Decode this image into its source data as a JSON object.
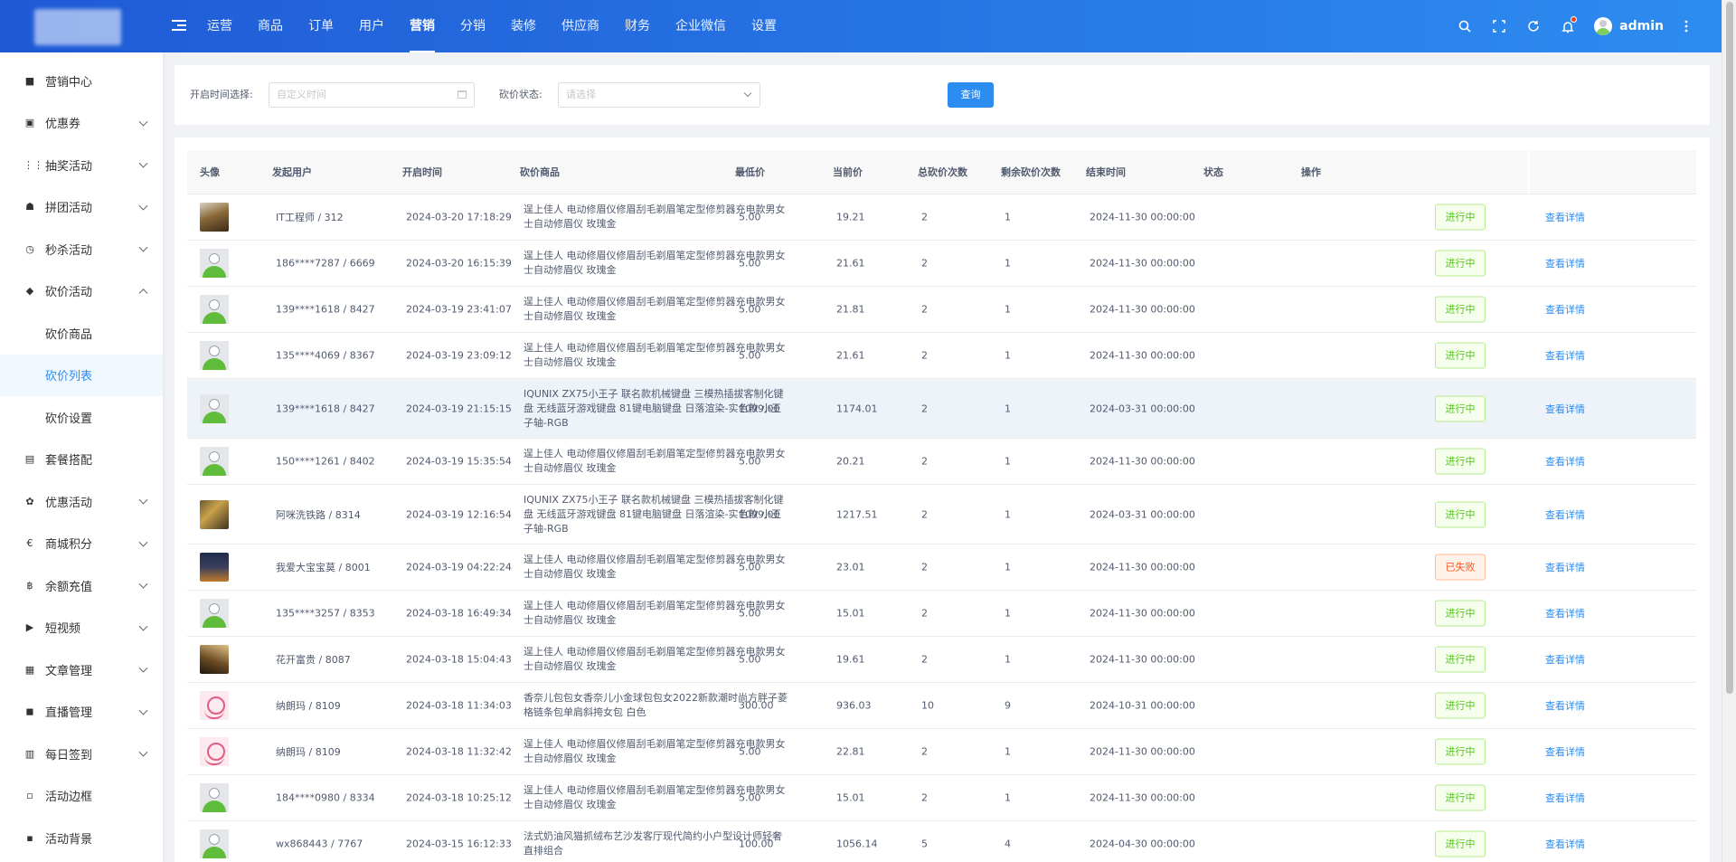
{
  "header": {
    "nav": [
      "运营",
      "商品",
      "订单",
      "用户",
      "营销",
      "分销",
      "装修",
      "供应商",
      "财务",
      "企业微信",
      "设置"
    ],
    "active_nav": 4,
    "username": "admin",
    "icons": [
      "search-icon",
      "fullscreen-icon",
      "refresh-icon",
      "bell-icon",
      "more-icon"
    ]
  },
  "sidebar": {
    "items": [
      {
        "label": "营销中心",
        "icon": "marketing-icon",
        "expand": false
      },
      {
        "label": "优惠券",
        "icon": "lock-icon",
        "expand": true
      },
      {
        "label": "抽奖活动",
        "icon": "grid-icon",
        "expand": true
      },
      {
        "label": "拼团活动",
        "icon": "group-icon",
        "expand": true
      },
      {
        "label": "秒杀活动",
        "icon": "clock-icon",
        "expand": true
      },
      {
        "label": "砍价活动",
        "icon": "tag-icon",
        "expand": true,
        "open": true
      },
      {
        "label": "套餐搭配",
        "icon": "package-icon",
        "expand": false
      },
      {
        "label": "优惠活动",
        "icon": "gift-icon",
        "expand": true
      },
      {
        "label": "商城积分",
        "icon": "points-icon",
        "expand": true
      },
      {
        "label": "余额充值",
        "icon": "balance-icon",
        "expand": true
      },
      {
        "label": "短视频",
        "icon": "video-icon",
        "expand": true
      },
      {
        "label": "文章管理",
        "icon": "article-icon",
        "expand": true
      },
      {
        "label": "直播管理",
        "icon": "live-icon",
        "expand": true
      },
      {
        "label": "每日签到",
        "icon": "calendar-icon",
        "expand": true
      },
      {
        "label": "活动边框",
        "icon": "frame-icon",
        "expand": false
      },
      {
        "label": "活动背景",
        "icon": "background-icon",
        "expand": false
      }
    ],
    "sub_items": [
      "砍价商品",
      "砍价列表",
      "砍价设置"
    ],
    "active_sub": 1
  },
  "filter": {
    "time_label": "开启时间选择:",
    "time_placeholder": "自定义时间",
    "status_label": "砍价状态:",
    "status_placeholder": "请选择",
    "query_label": "查询"
  },
  "table": {
    "columns": [
      "头像",
      "发起用户",
      "开启时间",
      "砍价商品",
      "最低价",
      "当前价",
      "总砍价次数",
      "剩余砍价次数",
      "结束时间",
      "状态",
      "操作"
    ],
    "action_label": "查看详情",
    "rows": [
      {
        "avatar": "photo1",
        "user": "IT工程师 / 312",
        "start": "2024-03-20 17:18:29",
        "product": "逞上佳人 电动修眉仪修眉刮毛剃眉笔定型修剪器充电款男女士自动修眉仪 玫瑰金",
        "min": "5.00",
        "cur": "19.21",
        "total": "2",
        "remain": "1",
        "end": "2024-11-30 00:00:00",
        "status": "进行中",
        "status_type": "ok"
      },
      {
        "avatar": "default",
        "user": "186****7287 / 6669",
        "start": "2024-03-20 16:15:39",
        "product": "逞上佳人 电动修眉仪修眉刮毛剃眉笔定型修剪器充电款男女士自动修眉仪 玫瑰金",
        "min": "5.00",
        "cur": "21.61",
        "total": "2",
        "remain": "1",
        "end": "2024-11-30 00:00:00",
        "status": "进行中",
        "status_type": "ok"
      },
      {
        "avatar": "default",
        "user": "139****1618 / 8427",
        "start": "2024-03-19 23:41:07",
        "product": "逞上佳人 电动修眉仪修眉刮毛剃眉笔定型修剪器充电款男女士自动修眉仪 玫瑰金",
        "min": "5.00",
        "cur": "21.81",
        "total": "2",
        "remain": "1",
        "end": "2024-11-30 00:00:00",
        "status": "进行中",
        "status_type": "ok"
      },
      {
        "avatar": "default",
        "user": "135****4069 / 8367",
        "start": "2024-03-19 23:09:12",
        "product": "逞上佳人 电动修眉仪修眉刮毛剃眉笔定型修剪器充电款男女士自动修眉仪 玫瑰金",
        "min": "5.00",
        "cur": "21.61",
        "total": "2",
        "remain": "1",
        "end": "2024-11-30 00:00:00",
        "status": "进行中",
        "status_type": "ok"
      },
      {
        "avatar": "default",
        "user": "139****1618 / 8427",
        "start": "2024-03-19 21:15:15",
        "product": "IQUNIX ZX75小王子 联名款机械键盘 三模热插拔客制化键盘 无线蓝牙游戏键盘 81键电脑键盘 日落渲染-实色款 小王子轴-RGB",
        "min": "1099.00",
        "cur": "1174.01",
        "total": "2",
        "remain": "1",
        "end": "2024-03-31 00:00:00",
        "status": "进行中",
        "status_type": "ok",
        "highlight": true
      },
      {
        "avatar": "default",
        "user": "150****1261 / 8402",
        "start": "2024-03-19 15:35:54",
        "product": "逞上佳人 电动修眉仪修眉刮毛剃眉笔定型修剪器充电款男女士自动修眉仪 玫瑰金",
        "min": "5.00",
        "cur": "20.21",
        "total": "2",
        "remain": "1",
        "end": "2024-11-30 00:00:00",
        "status": "进行中",
        "status_type": "ok"
      },
      {
        "avatar": "photo2",
        "user": "阿咪洗铁路 / 8314",
        "start": "2024-03-19 12:16:54",
        "product": "IQUNIX ZX75小王子 联名款机械键盘 三模热插拔客制化键盘 无线蓝牙游戏键盘 81键电脑键盘 日落渲染-实色款 小王子轴-RGB",
        "min": "1099.00",
        "cur": "1217.51",
        "total": "2",
        "remain": "1",
        "end": "2024-03-31 00:00:00",
        "status": "进行中",
        "status_type": "ok"
      },
      {
        "avatar": "photo3",
        "user": "我爱大宝宝莫 / 8001",
        "start": "2024-03-19 04:22:24",
        "product": "逞上佳人 电动修眉仪修眉刮毛剃眉笔定型修剪器充电款男女士自动修眉仪 玫瑰金",
        "min": "5.00",
        "cur": "23.01",
        "total": "2",
        "remain": "1",
        "end": "2024-11-30 00:00:00",
        "status": "已失败",
        "status_type": "fail"
      },
      {
        "avatar": "default",
        "user": "135****3257 / 8353",
        "start": "2024-03-18 16:49:34",
        "product": "逞上佳人 电动修眉仪修眉刮毛剃眉笔定型修剪器充电款男女士自动修眉仪 玫瑰金",
        "min": "5.00",
        "cur": "15.01",
        "total": "2",
        "remain": "1",
        "end": "2024-11-30 00:00:00",
        "status": "进行中",
        "status_type": "ok"
      },
      {
        "avatar": "photo4",
        "user": "花开富贵 / 8087",
        "start": "2024-03-18 15:04:43",
        "product": "逞上佳人 电动修眉仪修眉刮毛剃眉笔定型修剪器充电款男女士自动修眉仪 玫瑰金",
        "min": "5.00",
        "cur": "19.61",
        "total": "2",
        "remain": "1",
        "end": "2024-11-30 00:00:00",
        "status": "进行中",
        "status_type": "ok"
      },
      {
        "avatar": "pink",
        "user": "纳朗玛 / 8109",
        "start": "2024-03-18 11:34:03",
        "product": "香奈儿包包女香奈儿小金球包包女2022新款潮时尚方胖子菱格链条包单肩斜挎女包 白色",
        "min": "300.00",
        "cur": "936.03",
        "total": "10",
        "remain": "9",
        "end": "2024-10-31 00:00:00",
        "status": "进行中",
        "status_type": "ok"
      },
      {
        "avatar": "pink",
        "user": "纳朗玛 / 8109",
        "start": "2024-03-18 11:32:42",
        "product": "逞上佳人 电动修眉仪修眉刮毛剃眉笔定型修剪器充电款男女士自动修眉仪 玫瑰金",
        "min": "5.00",
        "cur": "22.81",
        "total": "2",
        "remain": "1",
        "end": "2024-11-30 00:00:00",
        "status": "进行中",
        "status_type": "ok"
      },
      {
        "avatar": "default",
        "user": "184****0980 / 8334",
        "start": "2024-03-18 10:25:12",
        "product": "逞上佳人 电动修眉仪修眉刮毛剃眉笔定型修剪器充电款男女士自动修眉仪 玫瑰金",
        "min": "5.00",
        "cur": "15.01",
        "total": "2",
        "remain": "1",
        "end": "2024-11-30 00:00:00",
        "status": "进行中",
        "status_type": "ok"
      },
      {
        "avatar": "default",
        "user": "wx868443 / 7767",
        "start": "2024-03-15 16:12:33",
        "product": "法式奶油风猫抓绒布艺沙发客厅现代简约小户型设计师轻奢直排组合",
        "min": "100.00",
        "cur": "1056.14",
        "total": "5",
        "remain": "4",
        "end": "2024-04-30 00:00:00",
        "status": "进行中",
        "status_type": "ok"
      }
    ]
  }
}
